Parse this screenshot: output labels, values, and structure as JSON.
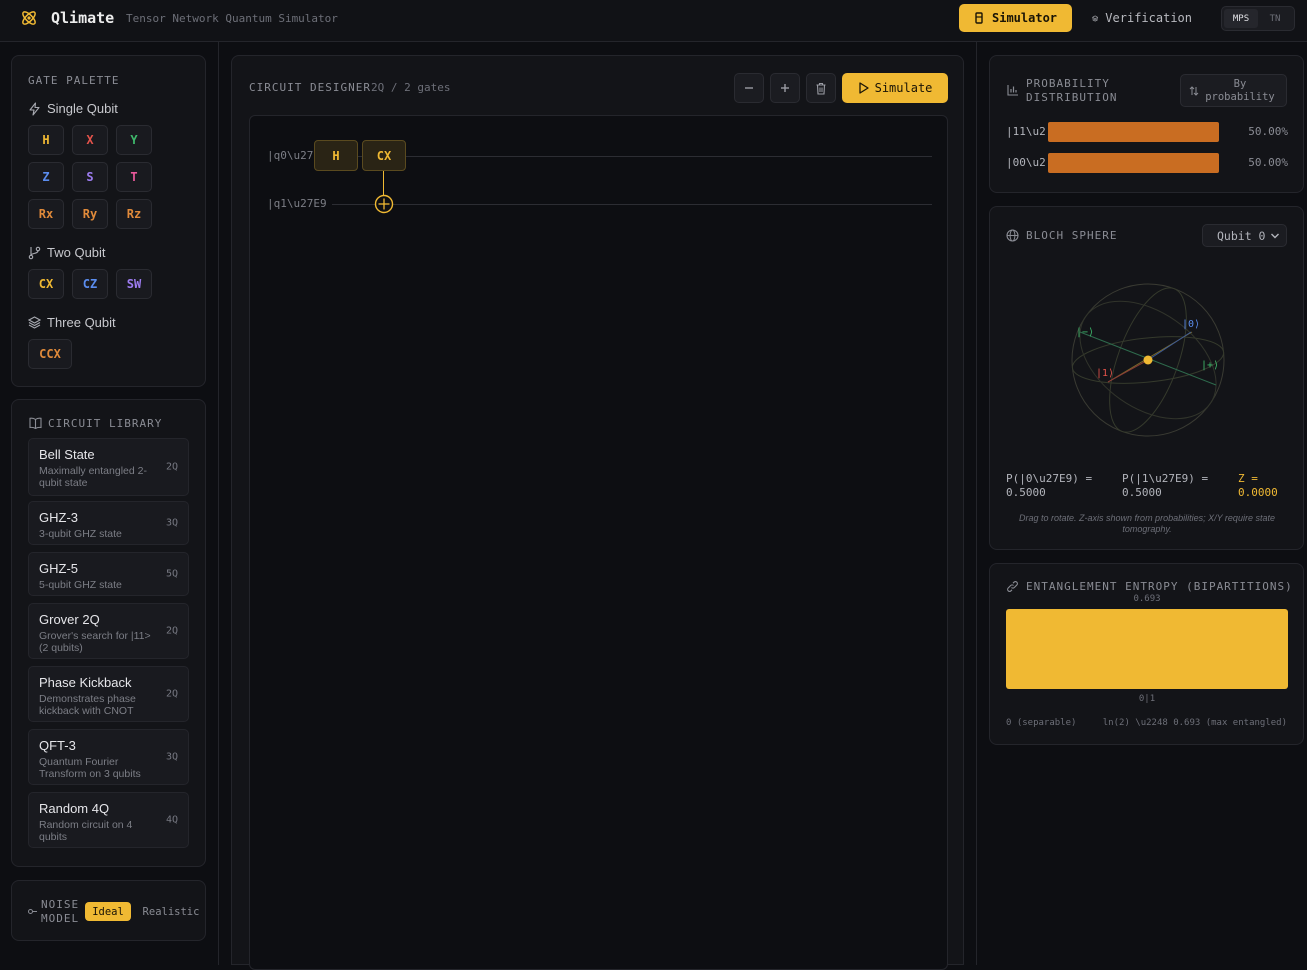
{
  "header": {
    "app_name": "Qlimate",
    "subtitle": "Tensor Network Quantum Simulator",
    "nav": {
      "simulator": "Simulator",
      "verification": "Verification"
    },
    "mode": {
      "mps": "MPS",
      "tn": "TN",
      "active": "MPS"
    }
  },
  "palette": {
    "title": "GATE PALETTE",
    "single_label": "Single Qubit",
    "single_gates": [
      {
        "label": "H",
        "color": "#f0b933"
      },
      {
        "label": "X",
        "color": "#e5534b"
      },
      {
        "label": "Y",
        "color": "#3fb96c"
      },
      {
        "label": "Z",
        "color": "#5b8def"
      },
      {
        "label": "S",
        "color": "#9d7cf0"
      },
      {
        "label": "T",
        "color": "#e8589a"
      },
      {
        "label": "Rx",
        "color": "#e08a3a"
      },
      {
        "label": "Ry",
        "color": "#e08a3a"
      },
      {
        "label": "Rz",
        "color": "#e08a3a"
      }
    ],
    "two_label": "Two Qubit",
    "two_gates": [
      {
        "label": "CX",
        "color": "#f0b933"
      },
      {
        "label": "CZ",
        "color": "#5b8def"
      },
      {
        "label": "SW",
        "color": "#9d7cf0"
      }
    ],
    "three_label": "Three Qubit",
    "three_gates": [
      {
        "label": "CCX",
        "color": "#e08a3a"
      }
    ]
  },
  "library": {
    "title": "CIRCUIT LIBRARY",
    "items": [
      {
        "name": "Bell State",
        "desc": "Maximally entangled 2-qubit state",
        "qubits": "2Q"
      },
      {
        "name": "GHZ-3",
        "desc": "3-qubit GHZ state",
        "qubits": "3Q"
      },
      {
        "name": "GHZ-5",
        "desc": "5-qubit GHZ state",
        "qubits": "5Q"
      },
      {
        "name": "Grover 2Q",
        "desc": "Grover's search for |11> (2 qubits)",
        "qubits": "2Q"
      },
      {
        "name": "Phase Kickback",
        "desc": "Demonstrates phase kickback with CNOT",
        "qubits": "2Q"
      },
      {
        "name": "QFT-3",
        "desc": "Quantum Fourier Transform on 3 qubits",
        "qubits": "3Q"
      },
      {
        "name": "Random 4Q",
        "desc": "Random circuit on 4 qubits",
        "qubits": "4Q"
      }
    ]
  },
  "noise": {
    "title_line1": "NOISE",
    "title_line2": "MODEL",
    "options": [
      "Ideal",
      "Realistic"
    ],
    "active": "Ideal"
  },
  "designer": {
    "title": "CIRCUIT DESIGNER",
    "count": "2Q / 2 gates",
    "simulate_label": "Simulate",
    "qubits": [
      "|q0\\u27E9",
      "|q1\\u27E9"
    ],
    "gates": [
      {
        "label": "H",
        "qubit": 0,
        "step": 0
      },
      {
        "label": "CX",
        "control": 0,
        "target": 1,
        "step": 1
      }
    ]
  },
  "probability": {
    "title_line1": "PROBABILITY",
    "title_line2": "DISTRIBUTION",
    "sort_line1": "By",
    "sort_line2": "probability",
    "bar_color": "#c96d22",
    "rows": [
      {
        "state": "|11\\u2",
        "value": 0.5,
        "pct": "50.00%"
      },
      {
        "state": "|00\\u2",
        "value": 0.5,
        "pct": "50.00%"
      }
    ]
  },
  "bloch": {
    "title": "BLOCH SPHERE",
    "qubit_select": "Qubit 0",
    "labels": {
      "zero": "|0⟩",
      "one": "|1⟩",
      "plus": "|+⟩",
      "minus": "|−⟩"
    },
    "p0": "P(|0\\u27E9) =",
    "p0_val": "0.5000",
    "p1": "P(|1\\u27E9) =",
    "p1_val": "0.5000",
    "z": "Z =",
    "z_val": "0.0000",
    "hint": "Drag to rotate. Z-axis shown from probabilities; X/Y require state tomography."
  },
  "entropy": {
    "title": "ENTANGLEMENT ENTROPY (BIPARTITIONS)",
    "value_label": "0.693",
    "value": 0.693,
    "max": 0.693,
    "partition": "0|1",
    "min_note": "0 (separable)",
    "max_note": "ln(2) \\u2248 0.693 (max entangled)",
    "bar_color": "#f0b933"
  }
}
